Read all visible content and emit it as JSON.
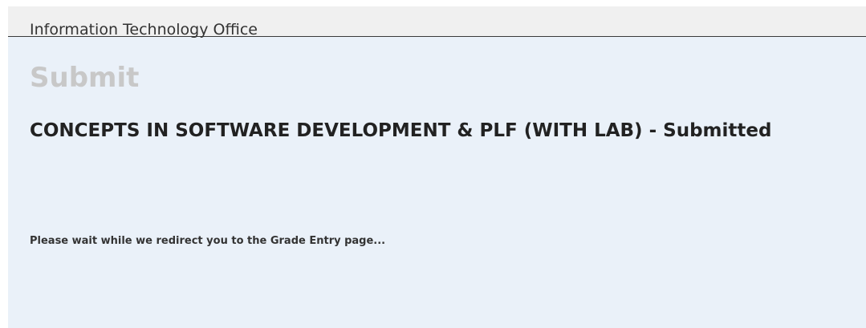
{
  "header": {
    "office_name": "Information Technology Office"
  },
  "main": {
    "page_title": "Submit",
    "status_title": "CONCEPTS IN SOFTWARE DEVELOPMENT & PLF (WITH LAB) - Submitted",
    "redirect_message": "Please wait while we redirect you to the Grade Entry page..."
  }
}
